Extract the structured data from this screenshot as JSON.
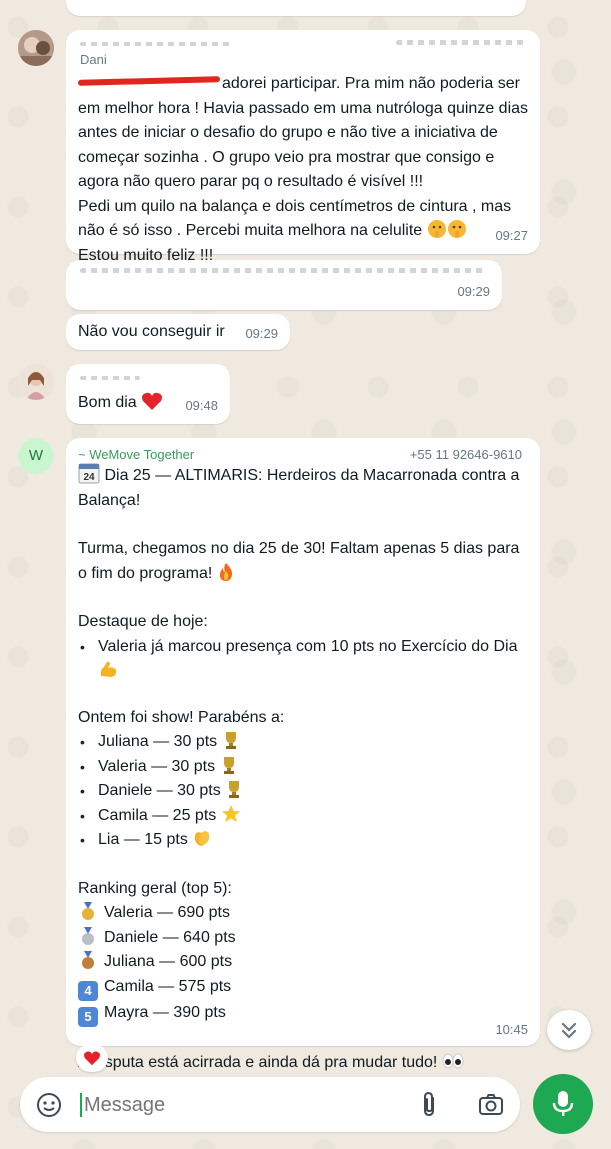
{
  "messages": [
    {
      "sender": "Dani",
      "body": "adorei participar. Pra mim não poderia ser em melhor hora ! Havia passado em uma nutróloga quinze dias antes de iniciar o desafio do grupo e não tive a iniciativa de começar sozinha . O grupo veio pra mostrar que consigo e agora não quero parar pq o resultado é visível !!!\nPedi um quilo na balança e dois centímetros de cintura , mas não é só isso . Percebi muita melhora na celulite",
      "body_end": "Estou muito feliz !!!",
      "time": "09:27"
    },
    {
      "time": "09:29"
    },
    {
      "body": "Não vou conseguir ir",
      "time": "09:29"
    },
    {
      "body": "Bom dia",
      "time": "09:48"
    }
  ],
  "wemove": {
    "sender": "~ WeMove Together",
    "phone": "+55 11 92646-9610",
    "calendar_day": "24",
    "title": "Dia 25 — ALTIMARIS: Herdeiros da Macarronada contra a Balança!",
    "intro_a": "Turma, chegamos no dia 25 de 30! Faltam apenas 5 dias para o fim do programa!",
    "highlight_heading": "Destaque de hoje:",
    "highlight_item": "Valeria já marcou presença com 10 pts no Exercício do Dia",
    "yesterday_heading": "Ontem foi show! Parabéns a:",
    "yesterday": [
      "Juliana — 30 pts",
      "Valeria — 30 pts",
      "Daniele — 30 pts",
      "Camila — 25 pts",
      "Lia — 15 pts"
    ],
    "ranking_heading": "Ranking geral (top 5):",
    "ranking": [
      "Valeria — 690 pts",
      "Daniele — 640 pts",
      "Juliana — 600 pts",
      "Camila — 575 pts",
      "Mayra — 390 pts"
    ],
    "ranking_badges": [
      "",
      "",
      "",
      "4",
      "5"
    ],
    "closing": "A disputa está acirrada e ainda dá pra mudar tudo!",
    "time": "10:45",
    "avatar_letter": "W"
  },
  "composer": {
    "placeholder": "Message"
  },
  "colors": {
    "send_green": "#1da851",
    "sender_green": "#3a9a5b",
    "wemove_avatar_bg": "#c9f5cf"
  },
  "icons": [
    "sticker-icon",
    "attach-icon",
    "camera-icon",
    "mic-icon",
    "scroll-down-icon",
    "heart-reaction-icon"
  ]
}
